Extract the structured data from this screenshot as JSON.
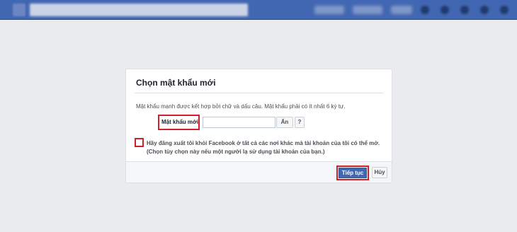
{
  "dialog": {
    "title": "Chọn mật khẩu mới",
    "hint": "Mật khẩu mạnh được kết hợp bởi chữ và dấu câu. Mật khẩu phải có ít nhất 6 ký tự.",
    "password_label": "Mật khẩu mới",
    "password_value": "",
    "hide_label": "Ẩn",
    "help_label": "?",
    "logout_checkbox_text": "Hãy đăng xuất tôi khỏi Facebook ở tất cả các nơi khác mà tài khoản của tôi có thể mở. (Chọn tùy chọn này nếu một người lạ sử dụng tài khoản của bạn.)",
    "logout_checked": false,
    "continue_label": "Tiếp tục",
    "cancel_label": "Hủy"
  },
  "colors": {
    "topbar": "#4267b2",
    "highlight": "#d0202a",
    "primary_button": "#4267b2",
    "background": "#e9ebee"
  },
  "icons": [
    "facebook-logo-icon",
    "friend-requests-icon",
    "messages-icon",
    "notifications-icon",
    "help-icon",
    "menu-icon"
  ]
}
